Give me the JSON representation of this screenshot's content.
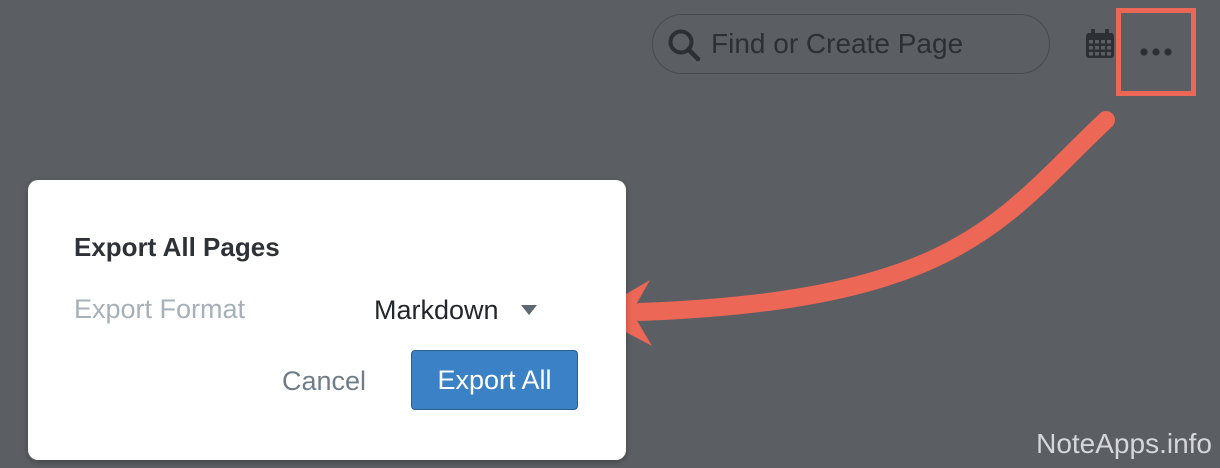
{
  "topbar": {
    "search": {
      "placeholder": "Find or Create Page",
      "icon": "search-icon"
    },
    "calendar_icon": "calendar-icon",
    "more_icon": "more-horizontal-icon",
    "highlight_color": "#ec6756"
  },
  "dialog": {
    "title": "Export All Pages",
    "format_label": "Export Format",
    "format_value": "Markdown",
    "cancel_label": "Cancel",
    "export_label": "Export All",
    "primary_color": "#3a81c5"
  },
  "annotation": {
    "arrow_color": "#ec6756"
  },
  "watermark": "NoteApps.info"
}
